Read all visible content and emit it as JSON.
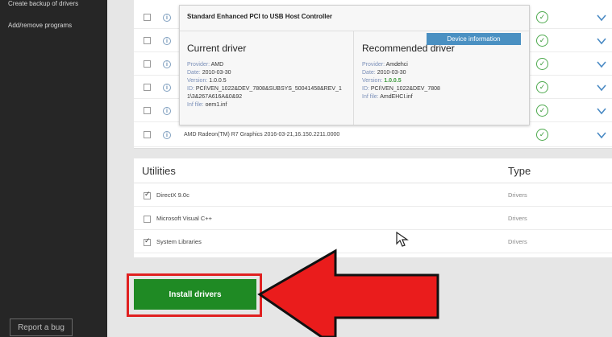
{
  "sidebar": {
    "items": [
      {
        "label": "Create backup of drivers"
      },
      {
        "label": "Add/remove programs"
      }
    ],
    "report_bug": "Report a bug"
  },
  "drivers": {
    "rows": [
      {
        "name": ""
      },
      {
        "name": ""
      },
      {
        "name": ""
      },
      {
        "name": ""
      },
      {
        "name": ""
      },
      {
        "name": "AMD Radeon(TM) R7 Graphics 2016-03-21,16.150.2211.0000"
      }
    ]
  },
  "popup": {
    "title": "Standard Enhanced PCI to USB Host Controller",
    "device_info_button": "Device information",
    "current": {
      "heading": "Current driver",
      "provider_label": "Provider: ",
      "provider": "AMD",
      "date_label": "Date: ",
      "date": "2010-03-30",
      "version_label": "Version: ",
      "version": "1.0.0.5",
      "id_label": "ID: ",
      "id_line1": "PCI\\VEN_1022&DEV_7808&SUBSYS_50041458&REV_1",
      "id_line2": "1\\3&267A616A&0&92",
      "inf_label": "Inf file: ",
      "inf": "oem1.inf"
    },
    "recommended": {
      "heading": "Recommended driver",
      "provider_label": "Provider: ",
      "provider": "Amdehci",
      "date_label": "Date: ",
      "date": "2010-03-30",
      "version_label": "Version: ",
      "version": "1.0.0.5",
      "id_label": "ID: ",
      "id": "PCI\\VEN_1022&DEV_7808",
      "inf_label": "Inf file: ",
      "inf": "AmdEHCI.inf"
    }
  },
  "utilities": {
    "title": "Utilities",
    "type_header": "Type",
    "rows": [
      {
        "name": "DirectX 9.0c",
        "type": "Drivers",
        "checked": true
      },
      {
        "name": "Microsoft Visual C++",
        "type": "Drivers",
        "checked": false
      },
      {
        "name": "System Libraries",
        "type": "Drivers",
        "checked": true
      }
    ]
  },
  "install_button": "Install drivers",
  "colors": {
    "sidebar": "#262626",
    "install": "#1f8a24",
    "highlight": "#e02020",
    "info_button": "#4a90c2",
    "ok_green": "#4eaa4e"
  }
}
